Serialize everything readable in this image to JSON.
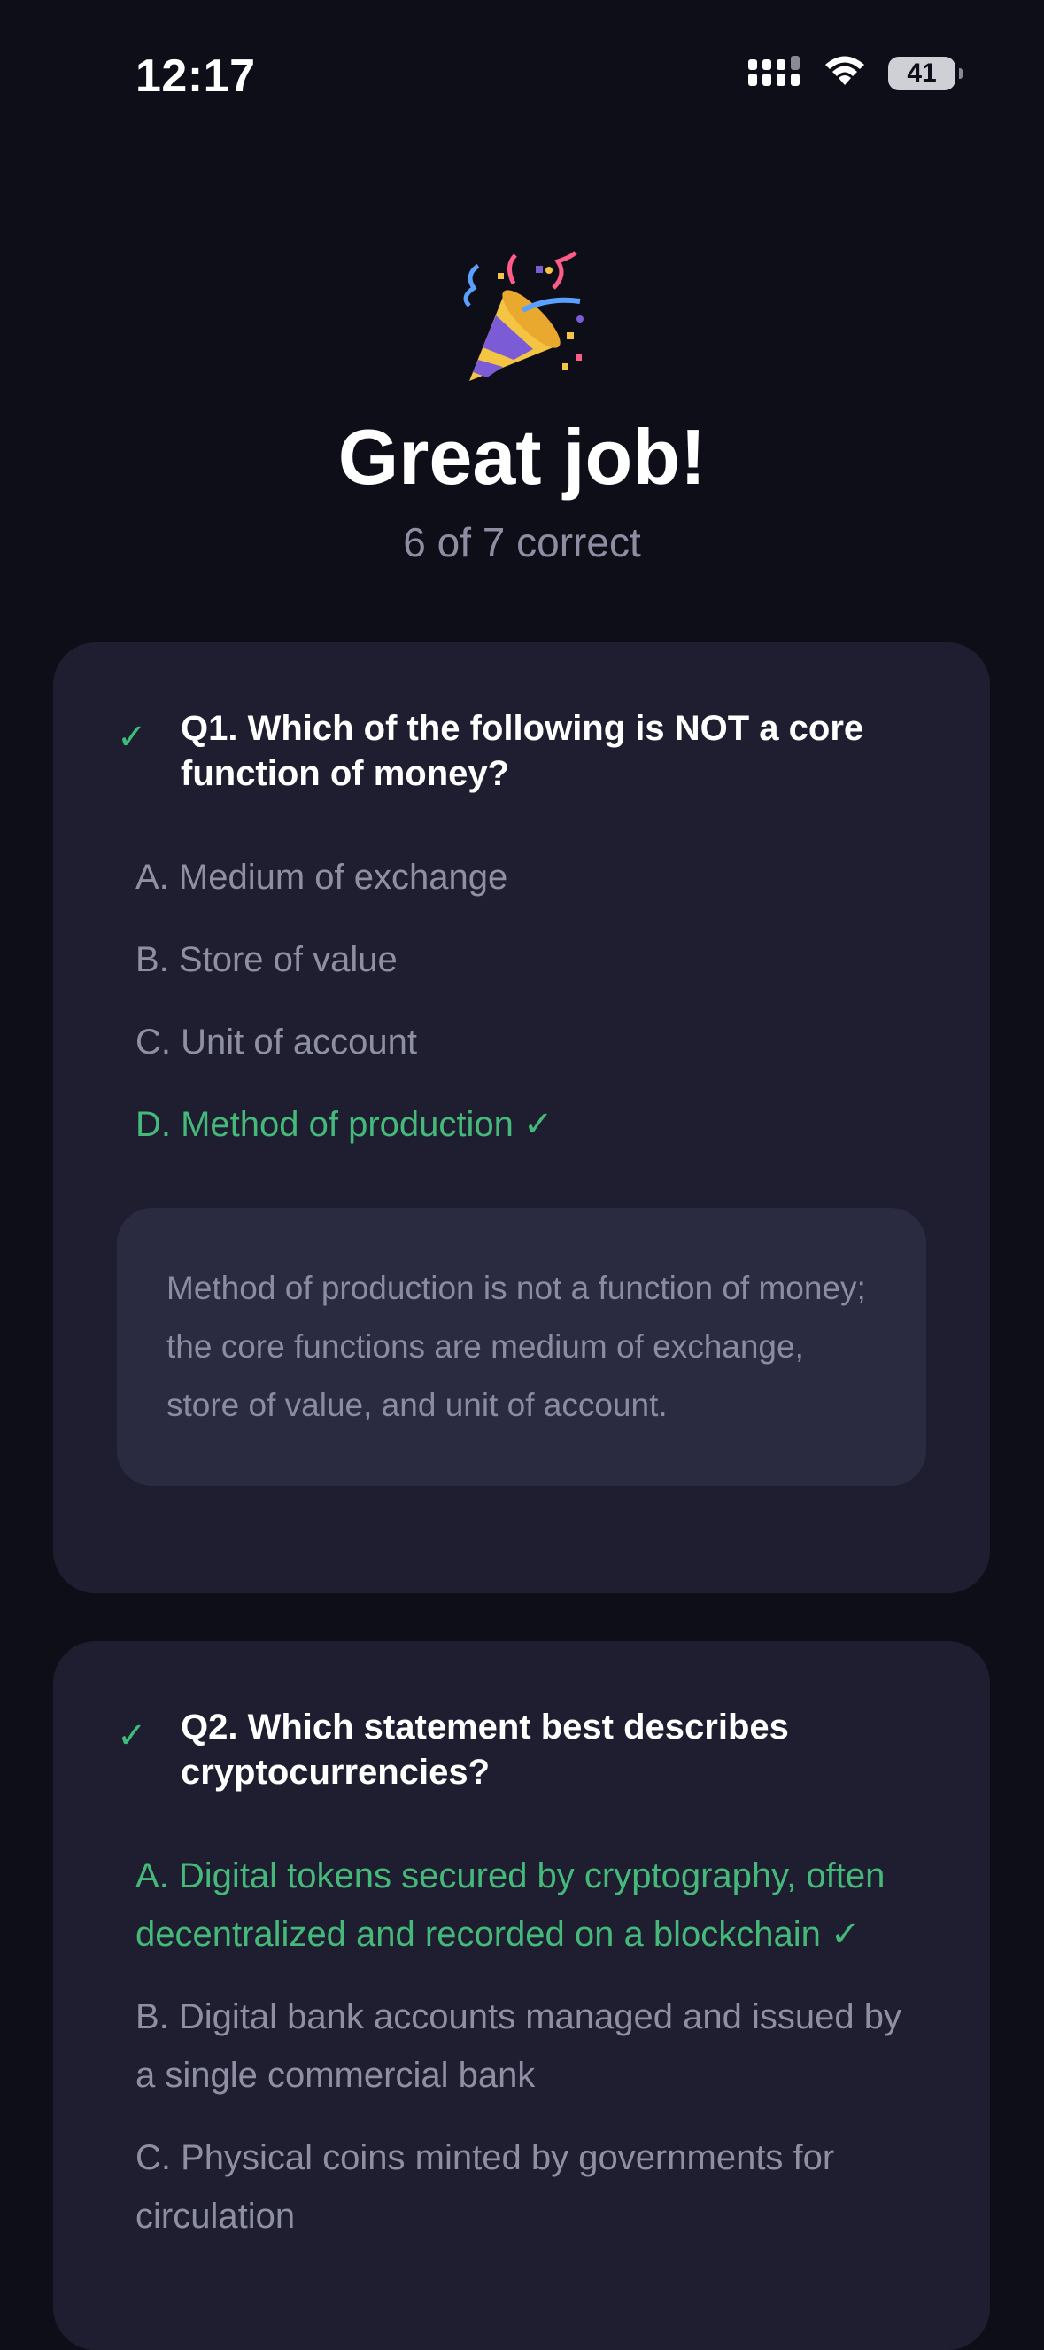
{
  "status_bar": {
    "time": "12:17",
    "battery": "41",
    "icons": [
      "cellular-signal-icon",
      "wifi-icon",
      "battery-icon"
    ]
  },
  "hero": {
    "emoji_icon": "party-popper-icon",
    "title": "Great job!",
    "score": "6 of 7 correct"
  },
  "colors": {
    "background": "#0e0e18",
    "card": "#1e1e30",
    "explanation": "#2a2a40",
    "correct": "#44b97a",
    "muted": "#8f8fa4"
  },
  "questions": [
    {
      "title": "Q1. Which of the following is NOT a core function of money?",
      "status_icon": "checkmark-icon",
      "options": [
        {
          "text": "A. Medium of exchange",
          "correct": false
        },
        {
          "text": "B. Store of value",
          "correct": false
        },
        {
          "text": "C. Unit of account",
          "correct": false
        },
        {
          "text": "D. Method of production ✓",
          "correct": true
        }
      ],
      "explanation": "Method of production is not a function of money; the core functions are medium of exchange, store of value, and unit of account."
    },
    {
      "title": "Q2. Which statement best describes cryptocurrencies?",
      "status_icon": "checkmark-icon",
      "options": [
        {
          "text": "A. Digital tokens secured by cryptography, often decentralized and recorded on a blockchain ✓",
          "correct": true
        },
        {
          "text": "B. Digital bank accounts managed and issued by a single commercial bank",
          "correct": false
        },
        {
          "text": "C. Physical coins minted by governments for circulation",
          "correct": false
        }
      ]
    }
  ]
}
